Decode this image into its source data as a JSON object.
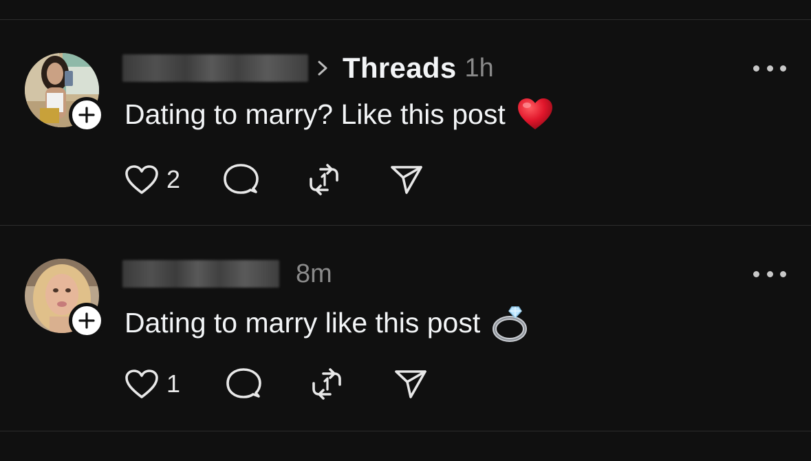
{
  "posts": [
    {
      "community": "Threads",
      "time": "1h",
      "text": "Dating to marry? Like this post",
      "emoji": "red-heart-emoji",
      "like_count": "2"
    },
    {
      "community": "",
      "time": "8m",
      "text": "Dating to marry like this post",
      "emoji": "ring-emoji",
      "like_count": "1"
    }
  ],
  "icons": {
    "like": "heart-icon",
    "reply": "comment-icon",
    "repost": "repost-icon",
    "share": "send-icon",
    "more": "more-horizontal-icon",
    "follow": "plus-icon"
  },
  "colors": {
    "background": "#101010",
    "text": "#f3f5f7",
    "secondary_text": "#8a8a8a",
    "divider": "#2d2d2d",
    "heart_emoji": "#e0162b"
  }
}
